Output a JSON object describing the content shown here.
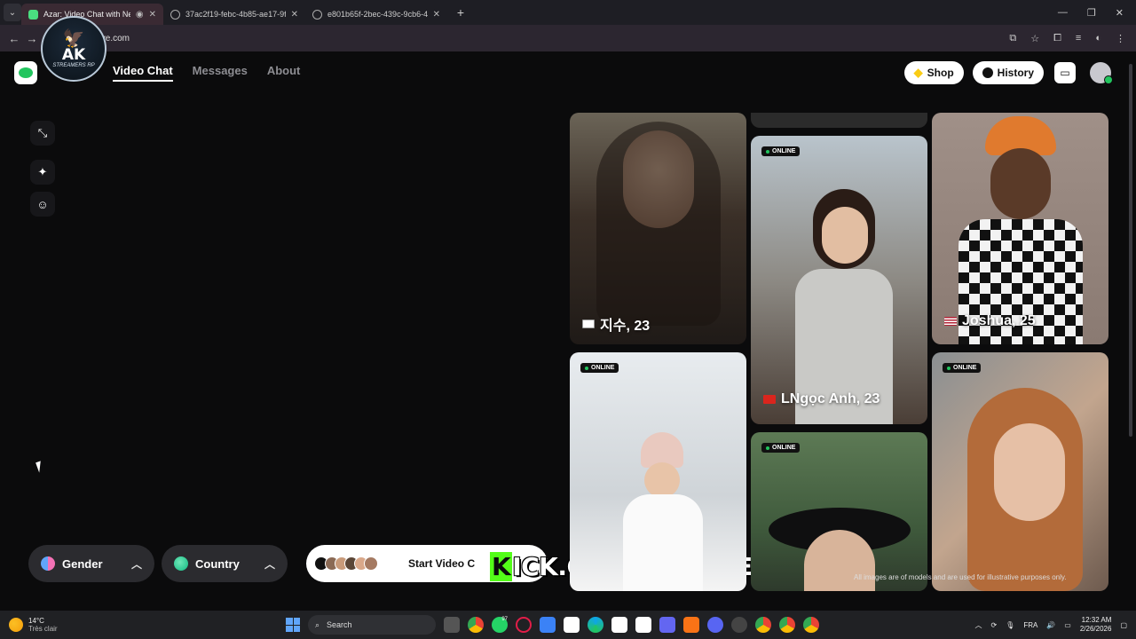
{
  "browser": {
    "tabs": [
      {
        "title": "Azar: Video Chat with New",
        "active": true
      },
      {
        "title": "37ac2f19-febc-4b85-ae17-9fe2",
        "active": false
      },
      {
        "title": "e801b65f-2bec-439c-9cb6-482",
        "active": false
      }
    ],
    "new_tab": "+",
    "url": "rlive.com"
  },
  "badge": {
    "text": "AK",
    "sub": "STREAMERS RP"
  },
  "header": {
    "nav": [
      "Video Chat",
      "Messages",
      "About"
    ],
    "shop_label": "Shop",
    "history_label": "History"
  },
  "filters": {
    "gender_label": "Gender",
    "country_label": "Country"
  },
  "start": {
    "label": "Start Video C"
  },
  "overlay": {
    "kick_k": "K",
    "kick_rest": "ICK.COM/ALIYUSE"
  },
  "cards": {
    "c1_name": "지수, 23",
    "c2_name": "LNgọc Anh, 23",
    "c3_name": "Joshua, 25",
    "online": "ONLINE"
  },
  "disclaimer": "All images are of models and are used for illustrative purposes only.",
  "taskbar": {
    "temp": "14°C",
    "condition": "Très clair",
    "search": "Search",
    "lang": "FRA",
    "time": "12:32 AM",
    "date": "2/26/2026",
    "badge1": "97"
  },
  "colors": {
    "accent": "#22c55e",
    "kick": "#53fc18",
    "background": "#0b0b0c"
  }
}
